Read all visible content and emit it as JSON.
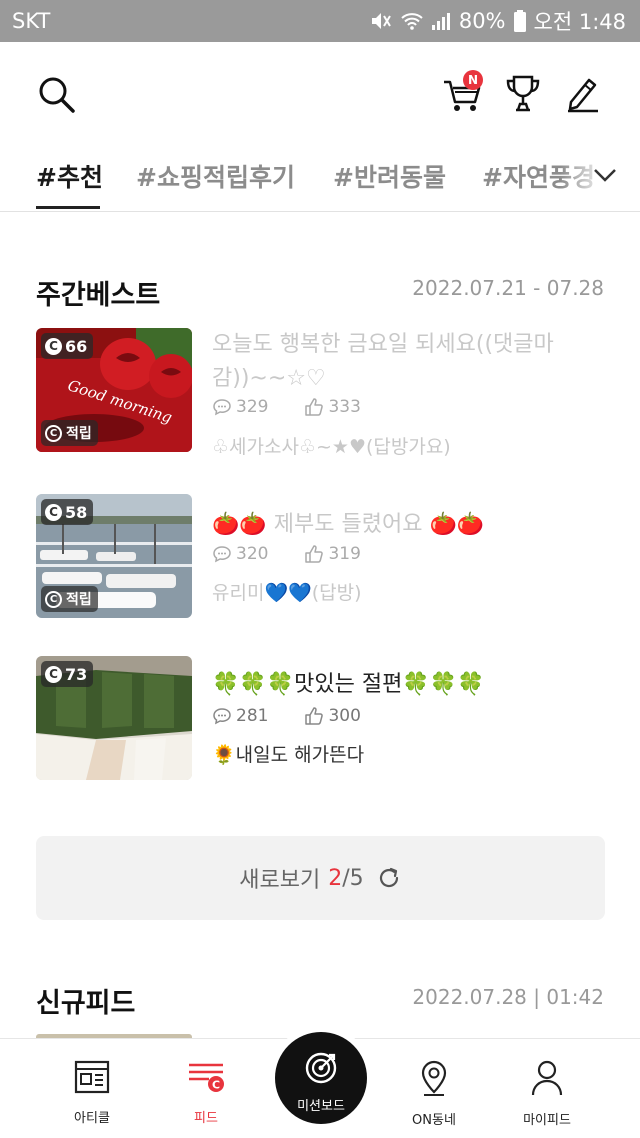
{
  "status_bar": {
    "carrier": "SKT",
    "battery": "80%",
    "time": "오전 1:48"
  },
  "header": {
    "icons": [
      "search-icon",
      "cart-icon",
      "trophy-icon",
      "pencil-icon"
    ],
    "cart_badge": "N"
  },
  "tabs": [
    {
      "label": "#추천",
      "active": true
    },
    {
      "label": "#쇼핑적립후기",
      "active": false
    },
    {
      "label": "#반려동물",
      "active": false
    },
    {
      "label": "#자연풍경",
      "active": false
    }
  ],
  "weekly_best": {
    "title": "주간베스트",
    "date_range": "2022.07.21 - 07.28",
    "items": [
      {
        "count": "66",
        "saved_label": "적립",
        "title": "오늘도 행복한 금요일 되세요((댓글마감))~~☆♡",
        "comments": "329",
        "likes": "333",
        "author": "♧세가소사♧~★♥(답방가요)",
        "read": true
      },
      {
        "count": "58",
        "saved_label": "적립",
        "title": "🍅🍅 제부도 들렸어요 🍅🍅",
        "comments": "320",
        "likes": "319",
        "author": "유리미💙💙(답방)",
        "read": true
      },
      {
        "count": "73",
        "saved_label": "",
        "title": "🍀🍀🍀맛있는 절편🍀🍀🍀",
        "comments": "281",
        "likes": "300",
        "author": "🌻내일도 해가뜬다",
        "read": false
      }
    ]
  },
  "refresh": {
    "label": "새로보기",
    "current": "2",
    "total": "/5"
  },
  "new_feed": {
    "title": "신규피드",
    "date": "2022.07.28 | 01:42"
  },
  "bottom_nav": {
    "article": "아티클",
    "feed": "피드",
    "mission": "미션보드",
    "on_town": "ON동네",
    "my_feed": "마이피드"
  },
  "colors": {
    "accent": "#e8343d",
    "status_bar": "#9a9a9a"
  }
}
